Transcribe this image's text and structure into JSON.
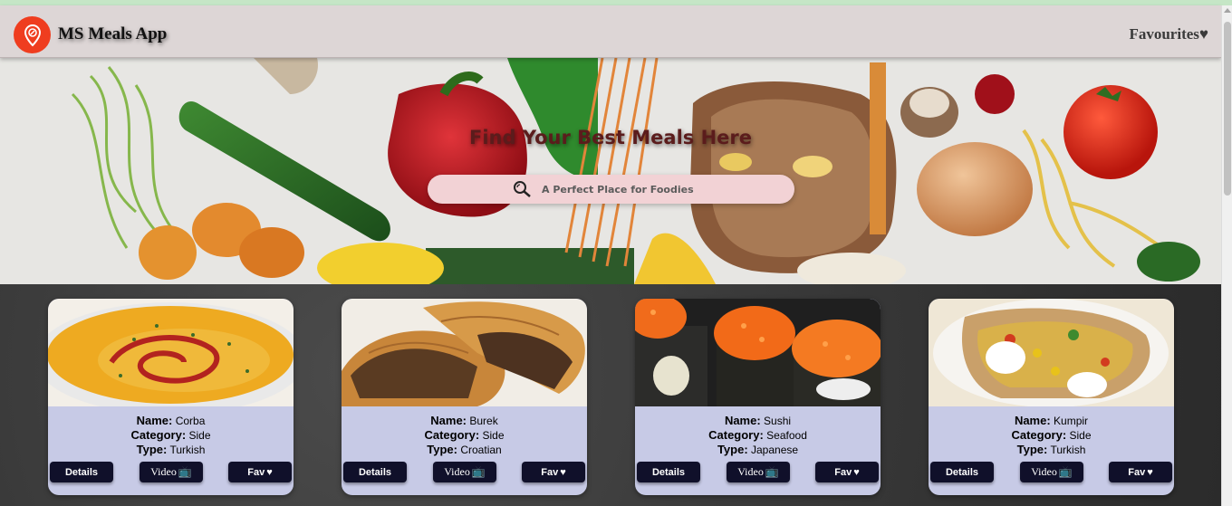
{
  "app": {
    "title": "MS Meals App",
    "brand_color": "#ef3d1f"
  },
  "nav": {
    "favourites_label": "Favourites♥"
  },
  "hero": {
    "heading": "Find Your Best Meals Here",
    "search_placeholder": "A Perfect Place for Foodies"
  },
  "labels": {
    "name": "Name:",
    "category": "Category:",
    "type": "Type:"
  },
  "buttons": {
    "details": "Details",
    "video": "Video",
    "video_icon": "📺",
    "fav": "Fav",
    "fav_icon": "♥"
  },
  "meals": [
    {
      "name": "Corba",
      "category": "Side",
      "type": "Turkish",
      "image": "soup"
    },
    {
      "name": "Burek",
      "category": "Side",
      "type": "Croatian",
      "image": "pastry"
    },
    {
      "name": "Sushi",
      "category": "Seafood",
      "type": "Japanese",
      "image": "sushi"
    },
    {
      "name": "Kumpir",
      "category": "Side",
      "type": "Turkish",
      "image": "stuffed-potato"
    }
  ],
  "icons": {
    "logo": "location-pin-fork-icon",
    "search": "magnifier-icon",
    "tv": "tv-icon",
    "heart": "heart-icon"
  }
}
